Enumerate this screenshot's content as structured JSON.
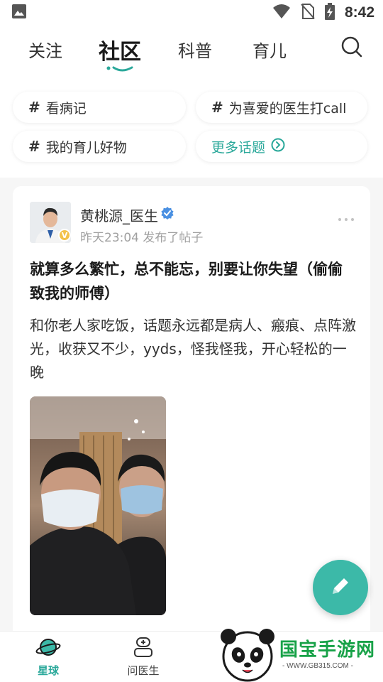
{
  "status_bar": {
    "time": "8:42",
    "icons": [
      "image-icon",
      "wifi-icon",
      "no-sim-icon",
      "battery-charging-icon"
    ]
  },
  "top_nav": {
    "tabs": [
      {
        "label": "关注",
        "active": false
      },
      {
        "label": "社区",
        "active": true
      },
      {
        "label": "科普",
        "active": false
      },
      {
        "label": "育儿",
        "active": false
      }
    ],
    "search_icon": "search-icon"
  },
  "topics": {
    "chips": [
      {
        "label": "看病记"
      },
      {
        "label": "为喜爱的医生打call"
      },
      {
        "label": "我的育儿好物"
      }
    ],
    "more_label": "更多话题"
  },
  "post": {
    "author": "黄桃源_医生",
    "verified": true,
    "avatar_badge": "V",
    "meta": "昨天23:04 发布了帖子",
    "title": "就算多么繁忙，总不能忘，别要让你失望（偷偷致我的师傅）",
    "body": "和你老人家吃饭，话题永远都是病人、瘢痕、点阵激光，收获又不少，yyds，怪我怪我，开心轻松的一晚"
  },
  "fab": {
    "icon": "pencil-icon"
  },
  "bottom_nav": {
    "items": [
      {
        "label": "星球",
        "icon": "planet-icon",
        "active": true
      },
      {
        "label": "问医生",
        "icon": "doctor-icon",
        "active": false
      }
    ]
  },
  "watermark": {
    "text": "国宝手游网",
    "url": "- WWW.GB315.COM -"
  },
  "colors": {
    "accent": "#2aa89a",
    "fab": "#3cb9a8",
    "verified": "#4a90e2",
    "badge": "#f3c24a"
  }
}
